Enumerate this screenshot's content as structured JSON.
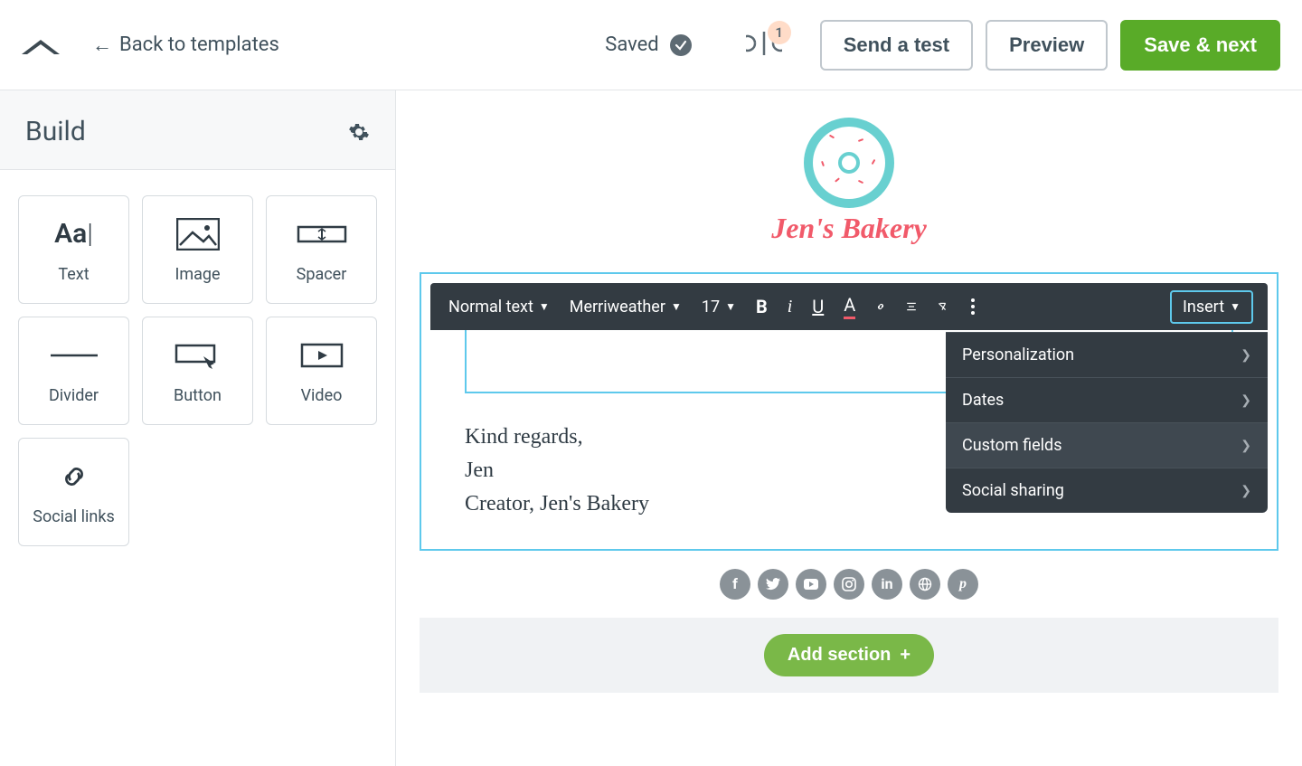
{
  "header": {
    "back_label": "Back to templates",
    "saved_label": "Saved",
    "badge_count": "1",
    "send_test_label": "Send a test",
    "preview_label": "Preview",
    "save_next_label": "Save & next"
  },
  "sidebar": {
    "title": "Build",
    "blocks": [
      {
        "label": "Text"
      },
      {
        "label": "Image"
      },
      {
        "label": "Spacer"
      },
      {
        "label": "Divider"
      },
      {
        "label": "Button"
      },
      {
        "label": "Video"
      },
      {
        "label": "Social links"
      }
    ]
  },
  "email": {
    "brand_name": "Jen's Bakery",
    "signature_line1": "Kind regards,",
    "signature_line2": "Jen",
    "signature_line3": "Creator, Jen's Bakery"
  },
  "toolbar": {
    "text_style": "Normal text",
    "font": "Merriweather",
    "font_size": "17",
    "insert_label": "Insert"
  },
  "insert_menu": {
    "items": [
      {
        "label": "Personalization"
      },
      {
        "label": "Dates"
      },
      {
        "label": "Custom fields"
      },
      {
        "label": "Social sharing"
      }
    ]
  },
  "add_section_label": "Add section",
  "social_icons": [
    "facebook",
    "twitter",
    "youtube",
    "instagram",
    "linkedin",
    "web",
    "pinterest"
  ]
}
